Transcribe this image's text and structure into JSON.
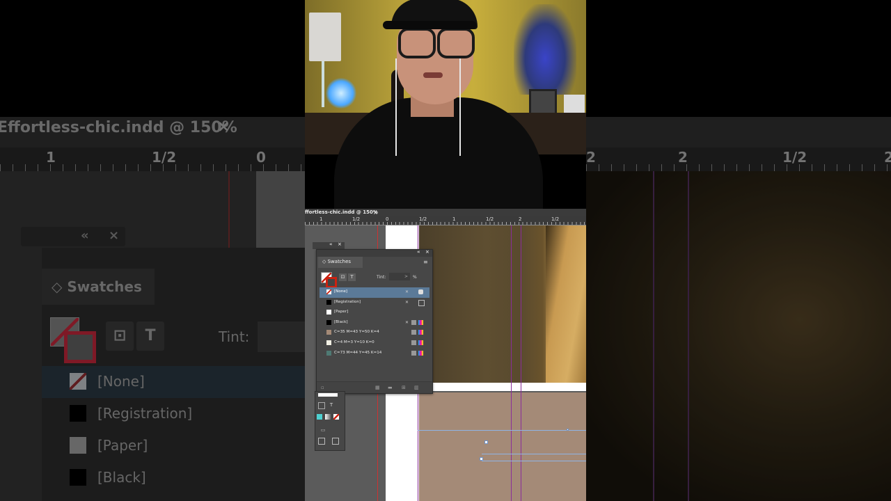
{
  "document": {
    "tab_title": "ffortless-chic.indd @ 150%",
    "tab_title_background": "Effortless-chic.indd @ 150%",
    "close_glyph": "×"
  },
  "ruler": {
    "labels": [
      "1",
      "1/2",
      "0",
      "1/2",
      "1",
      "1/2",
      "2",
      "1/2"
    ],
    "labels_background_left": [
      "1",
      "1/2",
      "0"
    ],
    "labels_background_right": [
      "2",
      "2",
      "1/2",
      "2"
    ]
  },
  "panel_chrome": {
    "collapse_glyph": "«",
    "close_glyph": "×"
  },
  "swatches": {
    "tab_label": "Swatches",
    "tab_label_background": "Swatches",
    "tint_label": "Tint:",
    "tint_value": ">",
    "tint_unit": "%",
    "formatting_box_glyph": "⊡",
    "text_glyph": "T",
    "menu_glyph": "≡",
    "items": [
      {
        "name": "[None]",
        "chip": "none",
        "selected": true
      },
      {
        "name": "[Registration]",
        "chip": "#000000",
        "selected": false
      },
      {
        "name": "[Paper]",
        "chip": "#ffffff",
        "selected": false
      },
      {
        "name": "[Black]",
        "chip": "#000000",
        "selected": false
      },
      {
        "name": "C=35 M=43 Y=50 K=4",
        "chip": "#a48a77",
        "selected": false
      },
      {
        "name": "C=4 M=3 Y=10 K=0",
        "chip": "#f2f0e4",
        "selected": false
      },
      {
        "name": "C=73 M=44 Y=45 K=14",
        "chip": "#4f7a74",
        "selected": false
      }
    ],
    "background_items": [
      "[None]",
      "[Registration]",
      "[Paper]",
      "[Black]"
    ]
  },
  "tools": {
    "text_glyph": "T"
  },
  "colors": {
    "selection": "#5b7a98",
    "swatch_beige": "#a48a77",
    "guide_purple": "#8a2d9a",
    "none_red": "#c21"
  }
}
